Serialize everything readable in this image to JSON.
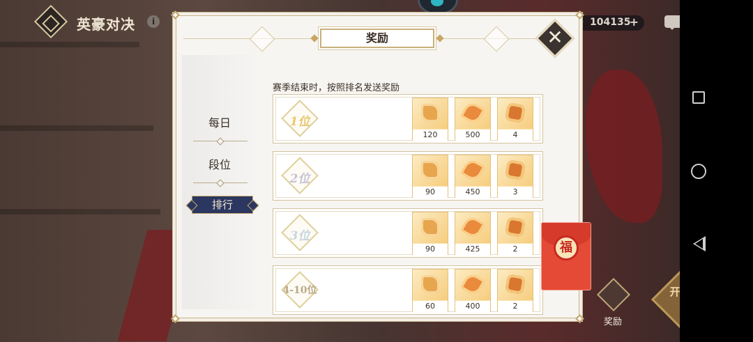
{
  "header": {
    "title": "英豪对决",
    "info_icon": "i",
    "currency": {
      "icon": "gem-icon",
      "value": "104135",
      "plus": "+"
    },
    "chat_icon": "chat-icon",
    "home_icon": "home-icon"
  },
  "background": {
    "reward_button_label": "奖励",
    "start_button_label": "开始匹配"
  },
  "modal": {
    "title": "奖励",
    "close_icon": "close-icon",
    "sidebar": {
      "items": [
        {
          "label": "每日",
          "active": false
        },
        {
          "label": "段位",
          "active": false
        },
        {
          "label": "排行",
          "active": true
        }
      ]
    },
    "description": "赛季结束时，按照排名发送奖励",
    "tiers": [
      {
        "rank": "1位",
        "rewards": [
          {
            "icon": "puzzle-icon",
            "qty": "120"
          },
          {
            "icon": "wing-icon",
            "qty": "500"
          },
          {
            "icon": "gem-icon",
            "qty": "4"
          }
        ]
      },
      {
        "rank": "2位",
        "rewards": [
          {
            "icon": "puzzle-icon",
            "qty": "90"
          },
          {
            "icon": "wing-icon",
            "qty": "450"
          },
          {
            "icon": "gem-icon",
            "qty": "3"
          }
        ]
      },
      {
        "rank": "3位",
        "rewards": [
          {
            "icon": "puzzle-icon",
            "qty": "90"
          },
          {
            "icon": "wing-icon",
            "qty": "425"
          },
          {
            "icon": "gem-icon",
            "qty": "2"
          }
        ]
      },
      {
        "rank": "4-10位",
        "rewards": [
          {
            "icon": "puzzle-icon",
            "qty": "60"
          },
          {
            "icon": "wing-icon",
            "qty": "400"
          },
          {
            "icon": "gem-icon",
            "qty": "2"
          }
        ]
      }
    ]
  },
  "red_envelope": {
    "glyph": "福"
  },
  "colors": {
    "accent_gold": "#c8b07c",
    "active_tab_bg": "#2b3760",
    "modal_bg": "#f7f5f1",
    "envelope_red": "#e54a36"
  }
}
